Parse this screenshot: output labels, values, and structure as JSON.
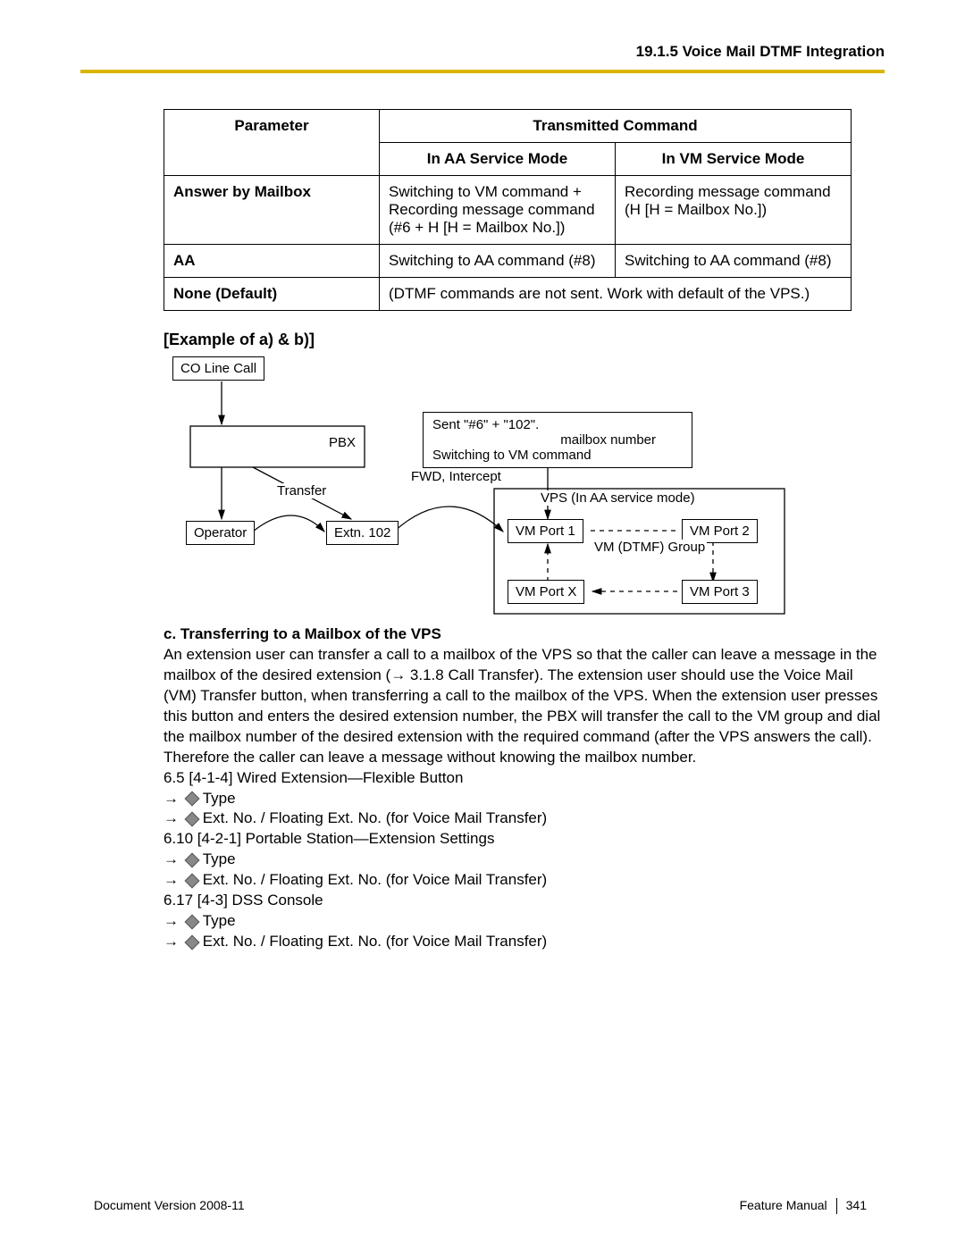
{
  "header": "19.1.5 Voice Mail DTMF Integration",
  "table": {
    "colParam": "Parameter",
    "colCmd": "Transmitted Command",
    "colAA": "In AA Service Mode",
    "colVM": "In VM Service Mode",
    "rows": [
      {
        "p": "Answer by Mailbox",
        "aa": "Switching to VM command + Recording message command (#6 + H [H = Mailbox No.])",
        "vm": "Recording message command (H [H = Mailbox No.])"
      },
      {
        "p": "AA",
        "aa": "Switching to AA command (#8)",
        "vm": "Switching to AA command (#8)"
      },
      {
        "p": "None (Default)",
        "full": "(DTMF commands are not sent. Work with default of the VPS.)"
      }
    ]
  },
  "exampleTitle": "[Example of a) & b)]",
  "diagram": {
    "co": "CO Line Call",
    "pbx": "PBX",
    "sent": "Sent \"#6\" + \"102\".",
    "mbx": "mailbox number",
    "swvm": "Switching to VM command",
    "fwd": "FWD, Intercept",
    "transfer": "Transfer",
    "op": "Operator",
    "extn": "Extn. 102",
    "vps": "VPS (In AA service mode)",
    "p1": "VM Port 1",
    "p2": "VM Port  2",
    "px": "VM Port  X",
    "p3": "VM Port  3",
    "grp": "VM (DTMF) Group"
  },
  "sectionC": {
    "title": "c.  Transferring to a Mailbox of the VPS",
    "body": "An extension user can transfer a call to a mailbox of the VPS so that the caller can leave a message in the mailbox of the desired extension (→ 3.1.8  Call Transfer). The extension user should use the Voice Mail (VM) Transfer button, when transferring a call to the mailbox of the VPS. When the extension user presses this button and enters the desired extension number, the PBX will transfer the call to the VM group and dial the mailbox number of the desired extension with the required command (after the VPS answers the call). Therefore the caller can leave a message without knowing the mailbox number.",
    "l65": "6.5  [4-1-4] Wired Extension—Flexible Button",
    "type": "Type",
    "ext": "Ext. No. / Floating Ext. No. (for Voice Mail Transfer)",
    "l610": "6.10  [4-2-1] Portable Station—Extension Settings",
    "l617": "6.17  [4-3] DSS Console"
  },
  "footer": {
    "docver": "Document Version  2008-11",
    "fm": "Feature Manual",
    "pg": "341"
  }
}
